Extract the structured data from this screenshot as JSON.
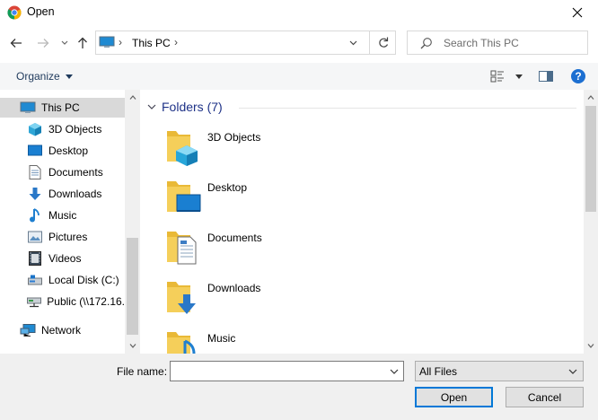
{
  "window": {
    "title": "Open",
    "icon": "chrome-icon"
  },
  "navigation": {
    "back_icon": "arrow-left-icon",
    "forward_icon": "arrow-right-icon",
    "recent_icon": "chevron-down-icon",
    "up_icon": "arrow-up-icon"
  },
  "address": {
    "location": "This PC",
    "refresh_icon": "refresh-icon"
  },
  "search": {
    "placeholder": "Search This PC"
  },
  "toolbar": {
    "organize_label": "Organize",
    "view_icon": "view-options-icon",
    "preview_icon": "preview-pane-icon",
    "help_icon": "help-icon",
    "help_glyph": "?"
  },
  "sidebar": {
    "items": [
      {
        "label": "This PC",
        "icon": "pc-icon"
      },
      {
        "label": "3D Objects",
        "icon": "cube-icon"
      },
      {
        "label": "Desktop",
        "icon": "desktop-icon"
      },
      {
        "label": "Documents",
        "icon": "document-icon"
      },
      {
        "label": "Downloads",
        "icon": "download-icon"
      },
      {
        "label": "Music",
        "icon": "music-icon"
      },
      {
        "label": "Pictures",
        "icon": "picture-icon"
      },
      {
        "label": "Videos",
        "icon": "video-icon"
      },
      {
        "label": "Local Disk (C:)",
        "icon": "disk-icon"
      },
      {
        "label": "Public (\\\\172.16.",
        "icon": "network-drive-icon"
      },
      {
        "label": "Network",
        "icon": "network-icon"
      }
    ]
  },
  "content": {
    "group_title": "Folders (7)",
    "folders": [
      {
        "name": "3D Objects",
        "icon": "folder-3d-objects-icon"
      },
      {
        "name": "Desktop",
        "icon": "folder-desktop-icon"
      },
      {
        "name": "Documents",
        "icon": "folder-documents-icon"
      },
      {
        "name": "Downloads",
        "icon": "folder-downloads-icon"
      },
      {
        "name": "Music",
        "icon": "folder-music-icon"
      }
    ]
  },
  "footer": {
    "file_name_label": "File name:",
    "file_name_value": "",
    "file_type": "All Files",
    "open_label": "Open",
    "cancel_label": "Cancel"
  },
  "colors": {
    "accent": "#0078d7",
    "selection": "#d9d9d9",
    "group_title": "#1e3287",
    "folder_yellow": "#f5c342"
  }
}
